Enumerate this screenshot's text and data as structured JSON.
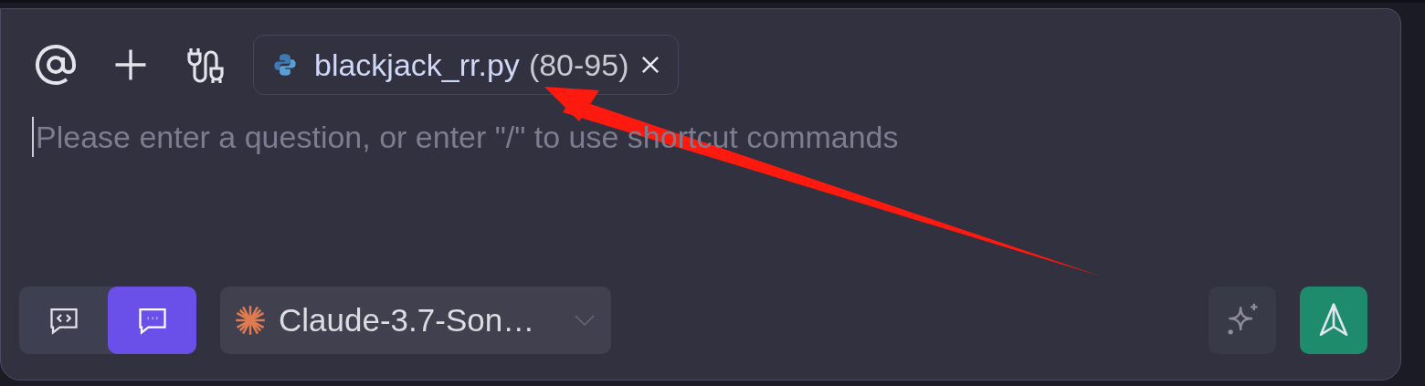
{
  "toolbar": {
    "context_chip": {
      "file_name": "blackjack_rr.py",
      "line_range": "(80-95)"
    }
  },
  "input": {
    "placeholder": "Please enter a question, or enter \"/\" to use shortcut commands"
  },
  "modes": [
    {
      "kind": "code",
      "selected": false
    },
    {
      "kind": "chat",
      "selected": true
    }
  ],
  "model_select": {
    "label": "Claude-3.7-Son…"
  }
}
